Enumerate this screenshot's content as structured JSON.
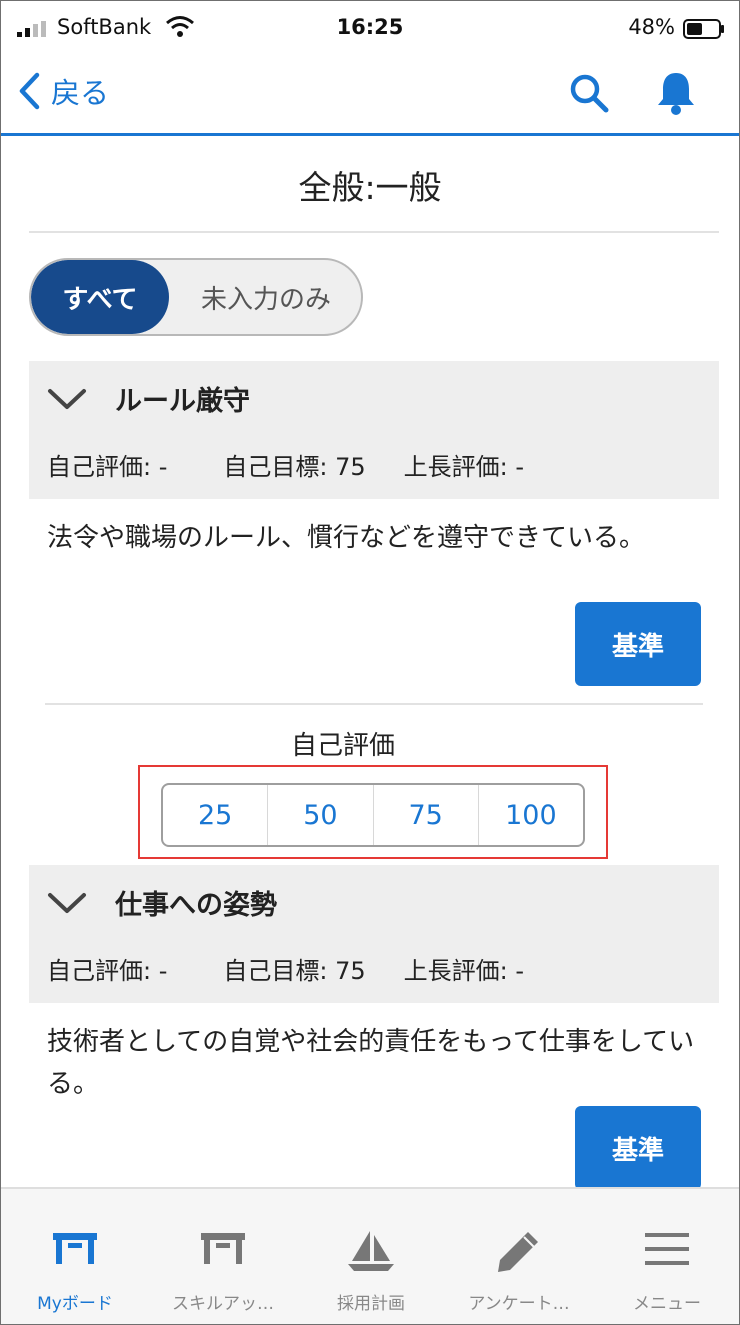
{
  "status": {
    "carrier": "SoftBank",
    "time": "16:25",
    "battery": "48%"
  },
  "nav": {
    "back_label": "戻る"
  },
  "page_title": "全般:一般",
  "filter": {
    "all_label": "すべて",
    "empty_only_label": "未入力のみ",
    "selected": "すべて"
  },
  "sections": [
    {
      "title": "ルール厳守",
      "self_rating": "自己評価: -",
      "self_goal": "自己目標: 75",
      "boss_rating": "上長評価: -",
      "description": "法令や職場のルール、慣行などを遵守できている。",
      "criteria_label": "基準",
      "rating_label": "自己評価",
      "rating_options": [
        "25",
        "50",
        "75",
        "100"
      ]
    },
    {
      "title": "仕事への姿勢",
      "self_rating": "自己評価: -",
      "self_goal": "自己目標: 75",
      "boss_rating": "上長評価: -",
      "description": "技術者としての自覚や社会的責任をもって仕事をしている。",
      "criteria_label": "基準"
    }
  ],
  "tabs": [
    {
      "label": "Myボード",
      "icon": "board-icon",
      "active": true
    },
    {
      "label": "スキルアッ…",
      "icon": "board-icon",
      "active": false
    },
    {
      "label": "採用計画",
      "icon": "sailboat-icon",
      "active": false
    },
    {
      "label": "アンケート…",
      "icon": "pencil-icon",
      "active": false
    },
    {
      "label": "メニュー",
      "icon": "hamburger-icon",
      "active": false
    }
  ],
  "colors": {
    "accent": "#1976d2",
    "toggle_selected": "#174a8c",
    "highlight": "#e53935"
  }
}
